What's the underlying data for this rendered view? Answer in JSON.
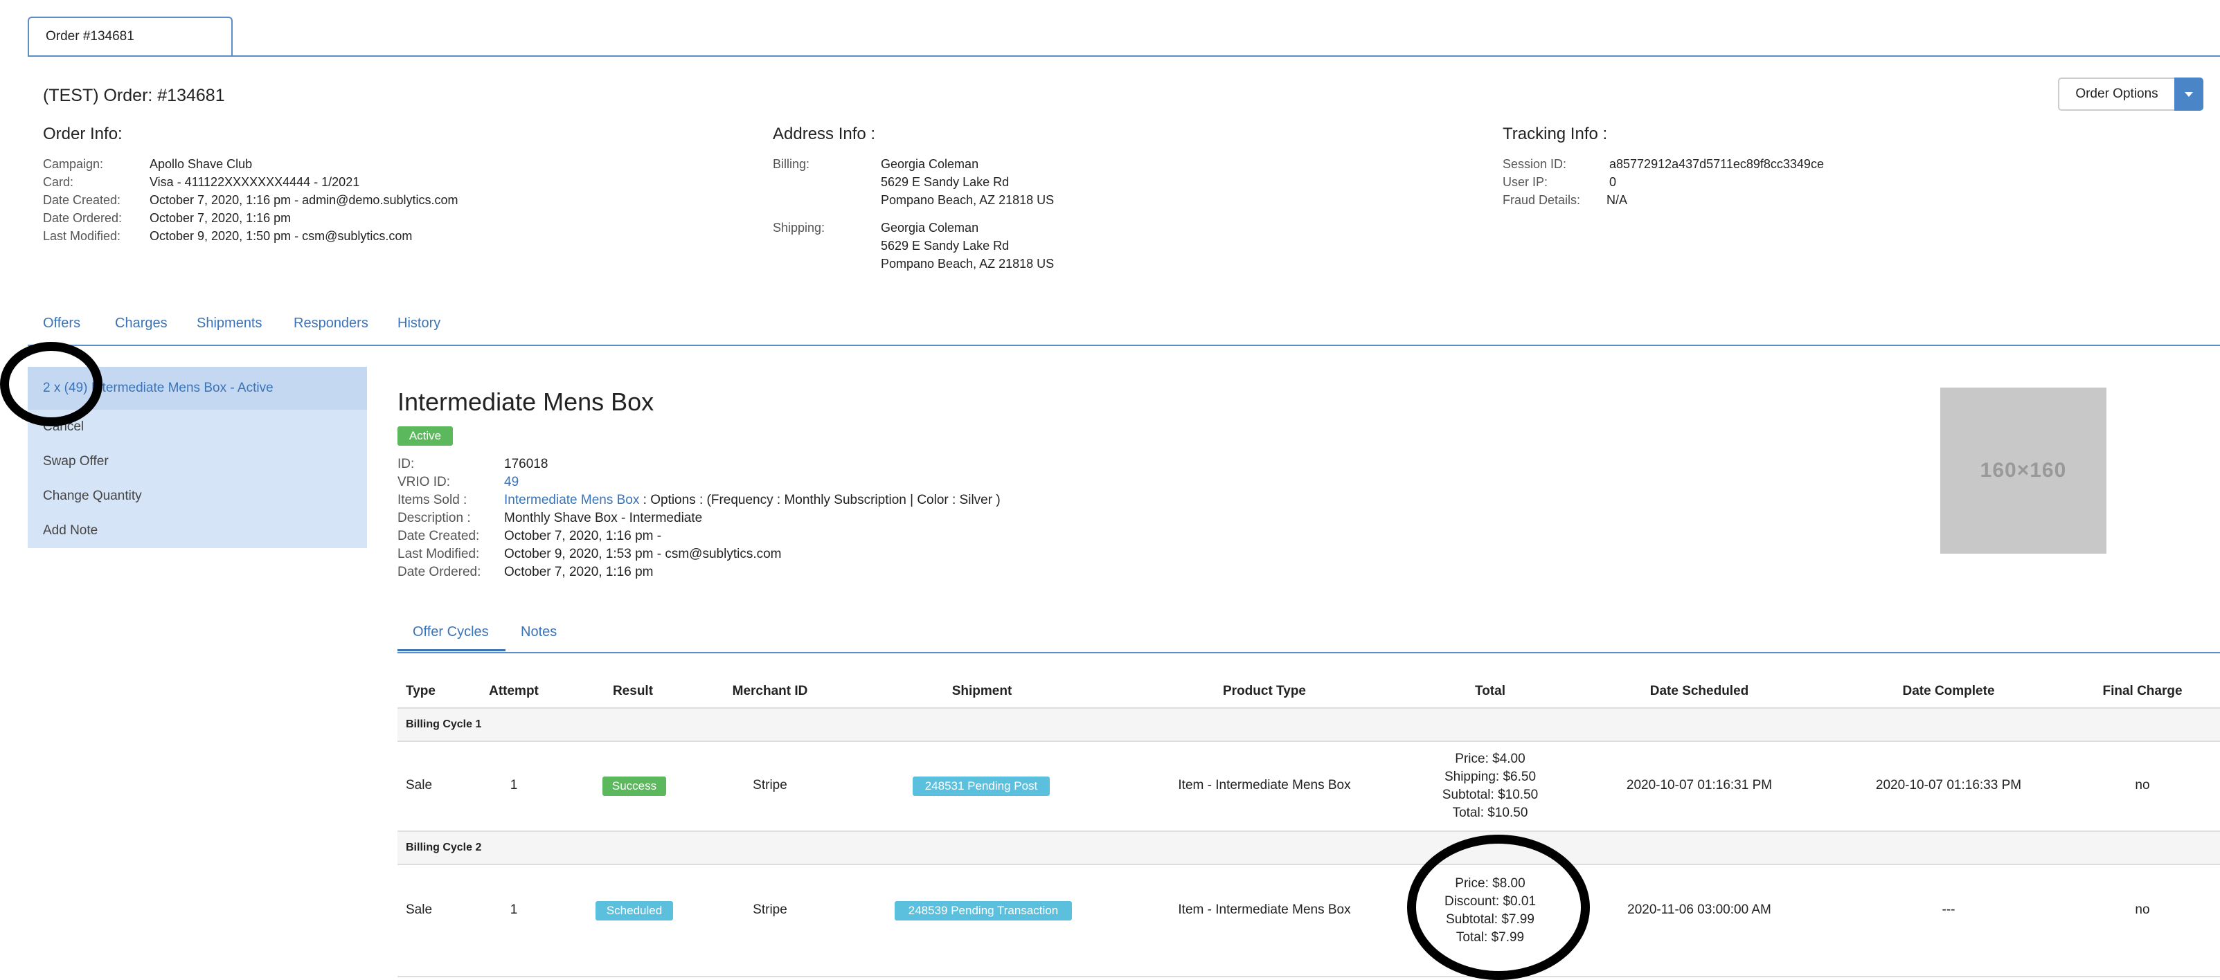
{
  "top_tab": "Order #134681",
  "order_title": "(TEST) Order: #134681",
  "order_options_label": "Order Options",
  "order_info": {
    "heading": "Order Info:",
    "rows": [
      {
        "k": "Campaign:",
        "v": "Apollo Shave Club"
      },
      {
        "k": "Card:",
        "v": "Visa - 411122XXXXXXX4444 - 1/2021"
      },
      {
        "k": "Date Created:",
        "v": "October 7, 2020, 1:16 pm - admin@demo.sublytics.com"
      },
      {
        "k": "Date Ordered:",
        "v": "October 7, 2020, 1:16 pm"
      },
      {
        "k": "Last Modified:",
        "v": "October 9, 2020, 1:50 pm - csm@sublytics.com"
      }
    ]
  },
  "address_info": {
    "heading": "Address Info :",
    "billing_label": "Billing:",
    "billing": [
      "Georgia Coleman",
      "5629 E Sandy Lake Rd",
      "Pompano Beach, AZ 21818 US"
    ],
    "shipping_label": "Shipping:",
    "shipping": [
      "Georgia Coleman",
      "5629 E Sandy Lake Rd",
      "Pompano Beach, AZ 21818 US"
    ]
  },
  "tracking_info": {
    "heading": "Tracking Info :",
    "rows": [
      {
        "k": "Session ID:",
        "v": "a85772912a437d5711ec89f8cc3349ce"
      },
      {
        "k": "User IP:",
        "v": "0"
      },
      {
        "k": "Fraud Details:",
        "v": "N/A"
      }
    ]
  },
  "nav_tabs": [
    "Offers",
    "Charges",
    "Shipments",
    "Responders",
    "History"
  ],
  "sidebar": {
    "active": "2 x (49) Intermediate Mens Box - Active",
    "items": [
      "Cancel",
      "Swap Offer",
      "Change Quantity",
      "Add Note"
    ]
  },
  "product": {
    "title": "Intermediate Mens Box",
    "status": "Active",
    "id_label": "ID:",
    "id": "176018",
    "vrio_label": "VRIO ID:",
    "vrio": "49",
    "items_label": "Items Sold :",
    "items_link": "Intermediate Mens Box",
    "items_rest": ": Options : (Frequency : Monthly Subscription | Color : Silver )",
    "desc_label": "Description :",
    "desc": "Monthly Shave Box - Intermediate",
    "created_label": "Date Created:",
    "created": "October 7, 2020, 1:16 pm -",
    "modified_label": "Last Modified:",
    "modified": "October 9, 2020, 1:53 pm - csm@sublytics.com",
    "ordered_label": "Date Ordered:",
    "ordered": "October 7, 2020, 1:16 pm",
    "image_text": "160×160"
  },
  "sub_tabs": [
    "Offer Cycles",
    "Notes"
  ],
  "table": {
    "headers": [
      "Type",
      "Attempt",
      "Result",
      "Merchant ID",
      "Shipment",
      "Product Type",
      "Total",
      "Date Scheduled",
      "Date Complete",
      "Final Charge"
    ],
    "cycles": [
      {
        "label": "Billing Cycle 1",
        "type": "Sale",
        "attempt": "1",
        "result": "Success",
        "merchant": "Stripe",
        "shipment": "248531 Pending Post",
        "product_type": "Item - Intermediate Mens Box",
        "total": [
          "Price: $4.00",
          "Shipping: $6.50",
          "Subtotal: $10.50",
          "Total: $10.50"
        ],
        "scheduled": "2020-10-07 01:16:31 PM",
        "complete": "2020-10-07 01:16:33 PM",
        "final": "no"
      },
      {
        "label": "Billing Cycle 2",
        "type": "Sale",
        "attempt": "1",
        "result": "Scheduled",
        "merchant": "Stripe",
        "shipment": "248539 Pending Transaction",
        "product_type": "Item - Intermediate Mens Box",
        "total": [
          "Price: $8.00",
          "Discount: $0.01",
          "Subtotal: $7.99",
          "Total: $7.99"
        ],
        "scheduled": "2020-11-06 03:00:00 AM",
        "complete": "---",
        "final": "no"
      }
    ]
  },
  "colors": {
    "link": "#3a73b8",
    "success": "#5cb85c",
    "info": "#5bc0de",
    "sidebar": "#d6e4f7"
  }
}
